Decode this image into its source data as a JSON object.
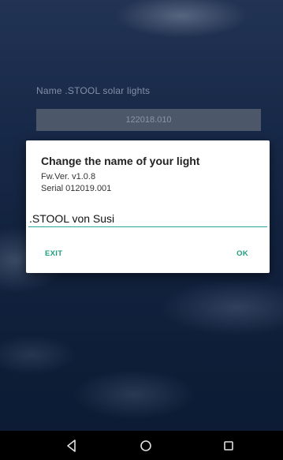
{
  "background": {
    "name_label": "Name .STOOL solar lights",
    "serial_bar": "122018.010"
  },
  "dialog": {
    "title": "Change the name of your light",
    "firmware": "Fw.Ver. v1.0.8",
    "serial": "Serial 012019.001",
    "input_value": ".STOOL von Susi",
    "exit_label": "EXIT",
    "ok_label": "OK",
    "accent_color": "#1e9e7e"
  },
  "navbar": {
    "back_icon": "back-triangle-icon",
    "home_icon": "home-circle-icon",
    "recents_icon": "recents-square-icon"
  }
}
